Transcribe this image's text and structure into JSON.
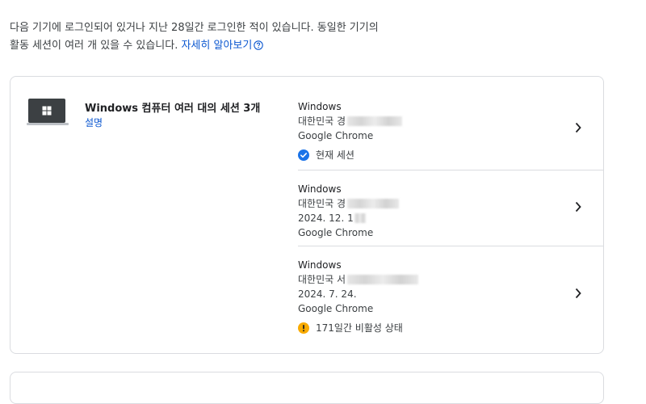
{
  "intro": {
    "line1": "다음 기기에 로그인되어 있거나 지난 28일간 로그인한 적이 있습니다. 동일한 기기의",
    "line2": "활동 세션이 여러 개 있을 수 있습니다. ",
    "link": "자세히 알아보기"
  },
  "group": {
    "title": "Windows 컴퓨터 여러 대의 세션 3개",
    "link": "설명",
    "sessions": [
      {
        "os": "Windows",
        "location": "대한민국 경",
        "browser": "Google Chrome",
        "status": "현재 세션"
      },
      {
        "os": "Windows",
        "location": "대한민국 경",
        "date": "2024. 12. 1",
        "browser": "Google Chrome"
      },
      {
        "os": "Windows",
        "location": "대한민국 서",
        "date": "2024. 7. 24.",
        "browser": "Google Chrome",
        "status": "171일간 비활성 상태"
      }
    ]
  },
  "colors": {
    "link": "#0b57d0",
    "current": "#1a73e8",
    "warning": "#f9ab00",
    "border": "#dadce0"
  },
  "icons": {
    "help": "help-circle-icon",
    "device": "laptop-windows-icon",
    "current": "check-circle-icon",
    "warning": "warning-circle-icon",
    "chevron": "chevron-right-icon"
  }
}
